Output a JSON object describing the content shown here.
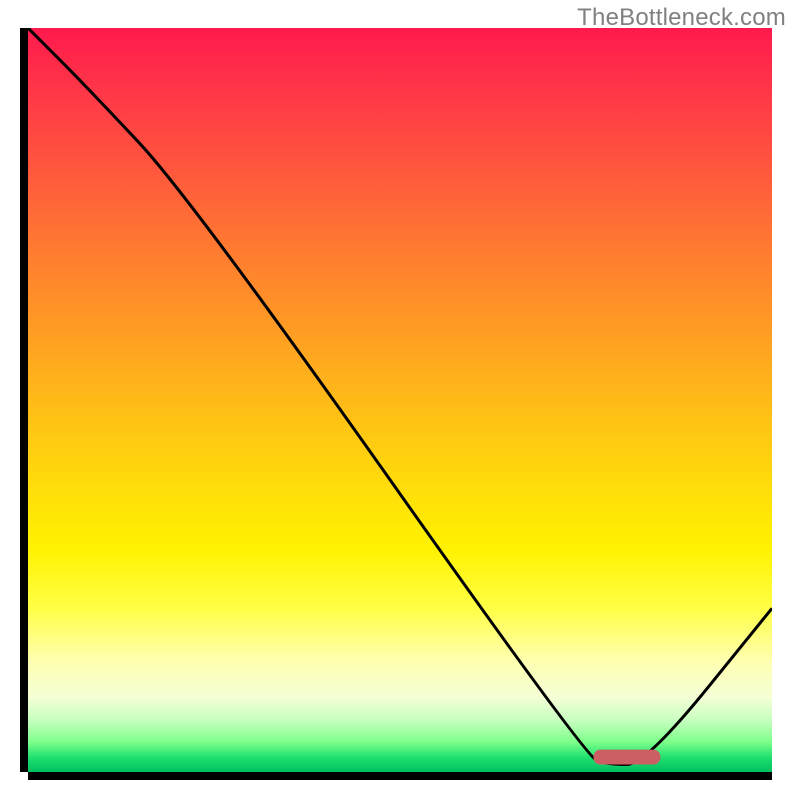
{
  "watermark": "TheBottleneck.com",
  "chart_data": {
    "type": "line",
    "title": "",
    "xlabel": "",
    "ylabel": "",
    "xlim": [
      0,
      100
    ],
    "ylim": [
      0,
      100
    ],
    "grid": false,
    "background_gradient": {
      "orientation": "vertical",
      "stops": [
        {
          "pos": 0,
          "color": "#ff1a4d"
        },
        {
          "pos": 50,
          "color": "#ffba18"
        },
        {
          "pos": 78,
          "color": "#ffff46"
        },
        {
          "pos": 96,
          "color": "#7dff8a"
        },
        {
          "pos": 100,
          "color": "#00c060"
        }
      ]
    },
    "series": [
      {
        "name": "bottleneck-curve",
        "x": [
          0,
          8,
          22,
          75,
          78,
          83,
          100
        ],
        "y": [
          100,
          92,
          77,
          2,
          1,
          1,
          22
        ],
        "stroke": "#000000",
        "stroke_width": 3
      }
    ],
    "markers": [
      {
        "name": "optimal-bar",
        "shape": "rounded-rect",
        "x_center": 80.5,
        "y_center": 2,
        "width": 9,
        "height": 2,
        "fill": "#cc5f63"
      }
    ]
  }
}
